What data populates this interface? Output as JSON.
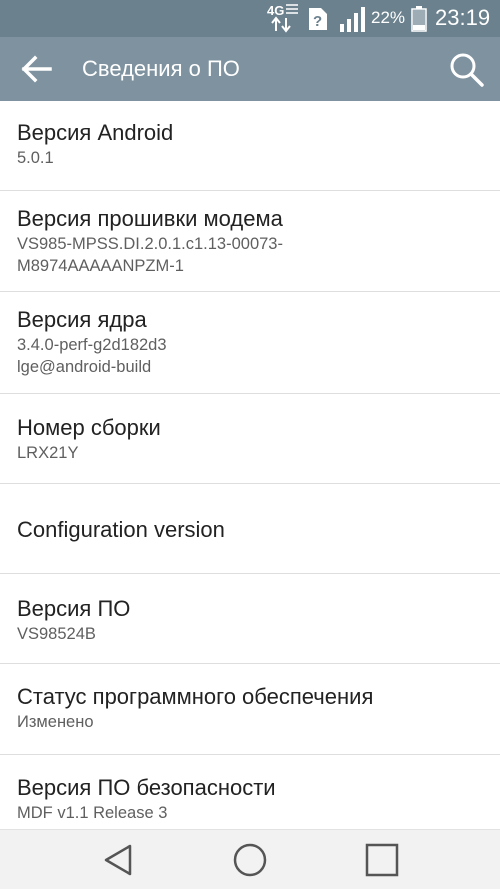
{
  "status_bar": {
    "network_label": "4G",
    "battery_percent": "22%",
    "time": "23:19",
    "icons": [
      "network-4g-icon",
      "unknown-notification-icon",
      "signal-icon",
      "battery-icon"
    ]
  },
  "app_bar": {
    "title": "Сведения о ПО",
    "back_icon": "arrow-left-icon",
    "search_icon": "search-icon"
  },
  "items": [
    {
      "title": "Версия Android",
      "lines": [
        "5.0.1"
      ]
    },
    {
      "title": "Версия прошивки модема",
      "lines": [
        "VS985-MPSS.DI.2.0.1.c1.13-00073-",
        "M8974AAAAANPZM-1"
      ]
    },
    {
      "title": "Версия ядра",
      "lines": [
        "3.4.0-perf-g2d182d3",
        "lge@android-build"
      ]
    },
    {
      "title": "Номер сборки",
      "lines": [
        "LRX21Y"
      ]
    },
    {
      "title": "Configuration version",
      "lines": []
    },
    {
      "title": "Версия ПО",
      "lines": [
        "VS98524B"
      ]
    },
    {
      "title": "Статус программного обеспечения",
      "lines": [
        "Изменено"
      ]
    },
    {
      "title": "Версия ПО безопасности",
      "lines": [
        "MDF v1.1 Release 3"
      ]
    }
  ],
  "nav_bar": {
    "icons": [
      "nav-back-icon",
      "nav-home-icon",
      "nav-recents-icon"
    ]
  },
  "colors": {
    "status_bar": "#6b818e",
    "app_bar": "#7e929f",
    "title_text": "#222222",
    "subtitle_text": "#5f5f5f",
    "divider": "#dedede",
    "nav_bar": "#f2f2f2"
  }
}
